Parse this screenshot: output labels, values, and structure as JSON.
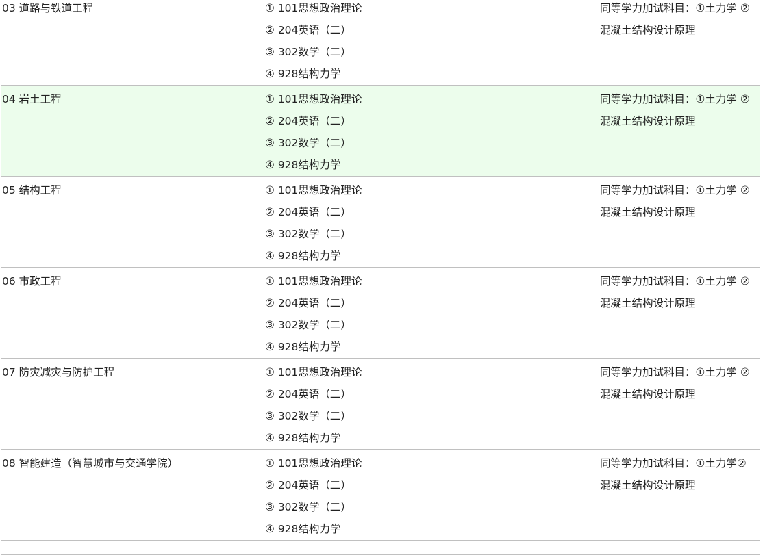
{
  "rows": [
    {
      "direction": "03 道路与铁道工程",
      "subjects": [
        "① 101思想政治理论",
        "② 204英语（二）",
        "③ 302数学（二）",
        "④ 928结构力学"
      ],
      "note_line1": "同等学力加试科目：①土力学 ②",
      "note_line2": "混凝土结构设计原理"
    },
    {
      "direction": "04 岩土工程",
      "subjects": [
        "① 101思想政治理论",
        "② 204英语（二）",
        "③ 302数学（二）",
        "④ 928结构力学"
      ],
      "note_line1": "同等学力加试科目：①土力学 ②",
      "note_line2": "混凝土结构设计原理"
    },
    {
      "direction": "05 结构工程",
      "subjects": [
        "① 101思想政治理论",
        "② 204英语（二）",
        "③ 302数学（二）",
        "④ 928结构力学"
      ],
      "note_line1": "同等学力加试科目：①土力学 ②",
      "note_line2": "混凝土结构设计原理"
    },
    {
      "direction": "06 市政工程",
      "subjects": [
        "① 101思想政治理论",
        "② 204英语（二）",
        "③ 302数学（二）",
        "④ 928结构力学"
      ],
      "note_line1": "同等学力加试科目：①土力学 ②",
      "note_line2": "混凝土结构设计原理"
    },
    {
      "direction": "07 防灾减灾与防护工程",
      "subjects": [
        "① 101思想政治理论",
        "② 204英语（二）",
        "③ 302数学（二）",
        "④ 928结构力学"
      ],
      "note_line1": "同等学力加试科目：①土力学 ②",
      "note_line2": "混凝土结构设计原理"
    },
    {
      "direction": "08 智能建造（智慧城市与交通学院）",
      "subjects": [
        "① 101思想政治理论",
        "② 204英语（二）",
        "③ 302数学（二）",
        "④ 928结构力学"
      ],
      "note_line1": "同等学力加试科目：①土力学②",
      "note_line2": "混凝土结构设计原理"
    }
  ],
  "colors": {
    "highlight_row": "#ecfdec",
    "border": "#c0c0c0",
    "text": "#222222"
  }
}
